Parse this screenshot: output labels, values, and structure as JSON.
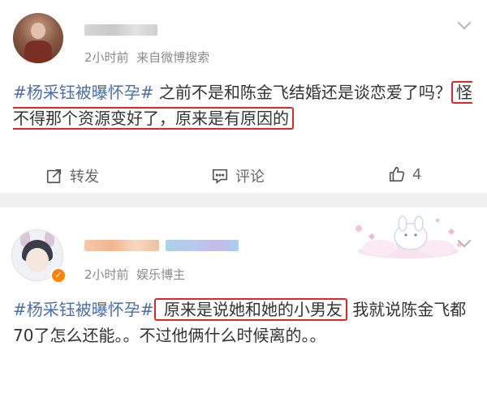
{
  "posts": [
    {
      "time": "2小时前",
      "source": "来自微博搜索",
      "hashtag": "#杨采钰被曝怀孕#",
      "text_before": " 之前不是和陈金飞结婚还是谈恋爱了吗？",
      "highlight": "怪不得那个资源变好了，原来是有原因的",
      "text_after": "",
      "actions": {
        "repost": "转发",
        "comment": "评论",
        "like_count": "4"
      }
    },
    {
      "time": "2小时前",
      "source": "娱乐博主",
      "hashtag": "#杨采钰被曝怀孕#",
      "highlight": " 原来是说她和她的小男友",
      "text_after": " 我就说陈金飞都70了怎么还能。。不过他俩什么时候离的。。"
    }
  ],
  "icons": [
    "repost-icon",
    "comment-icon",
    "like-icon",
    "chevron-down-icon",
    "verified-badge-icon"
  ],
  "colors": {
    "hashtag": "#4a6ea9",
    "highlight_border": "#e02626",
    "meta": "#8a8a8a",
    "badge": "#ff8200"
  }
}
